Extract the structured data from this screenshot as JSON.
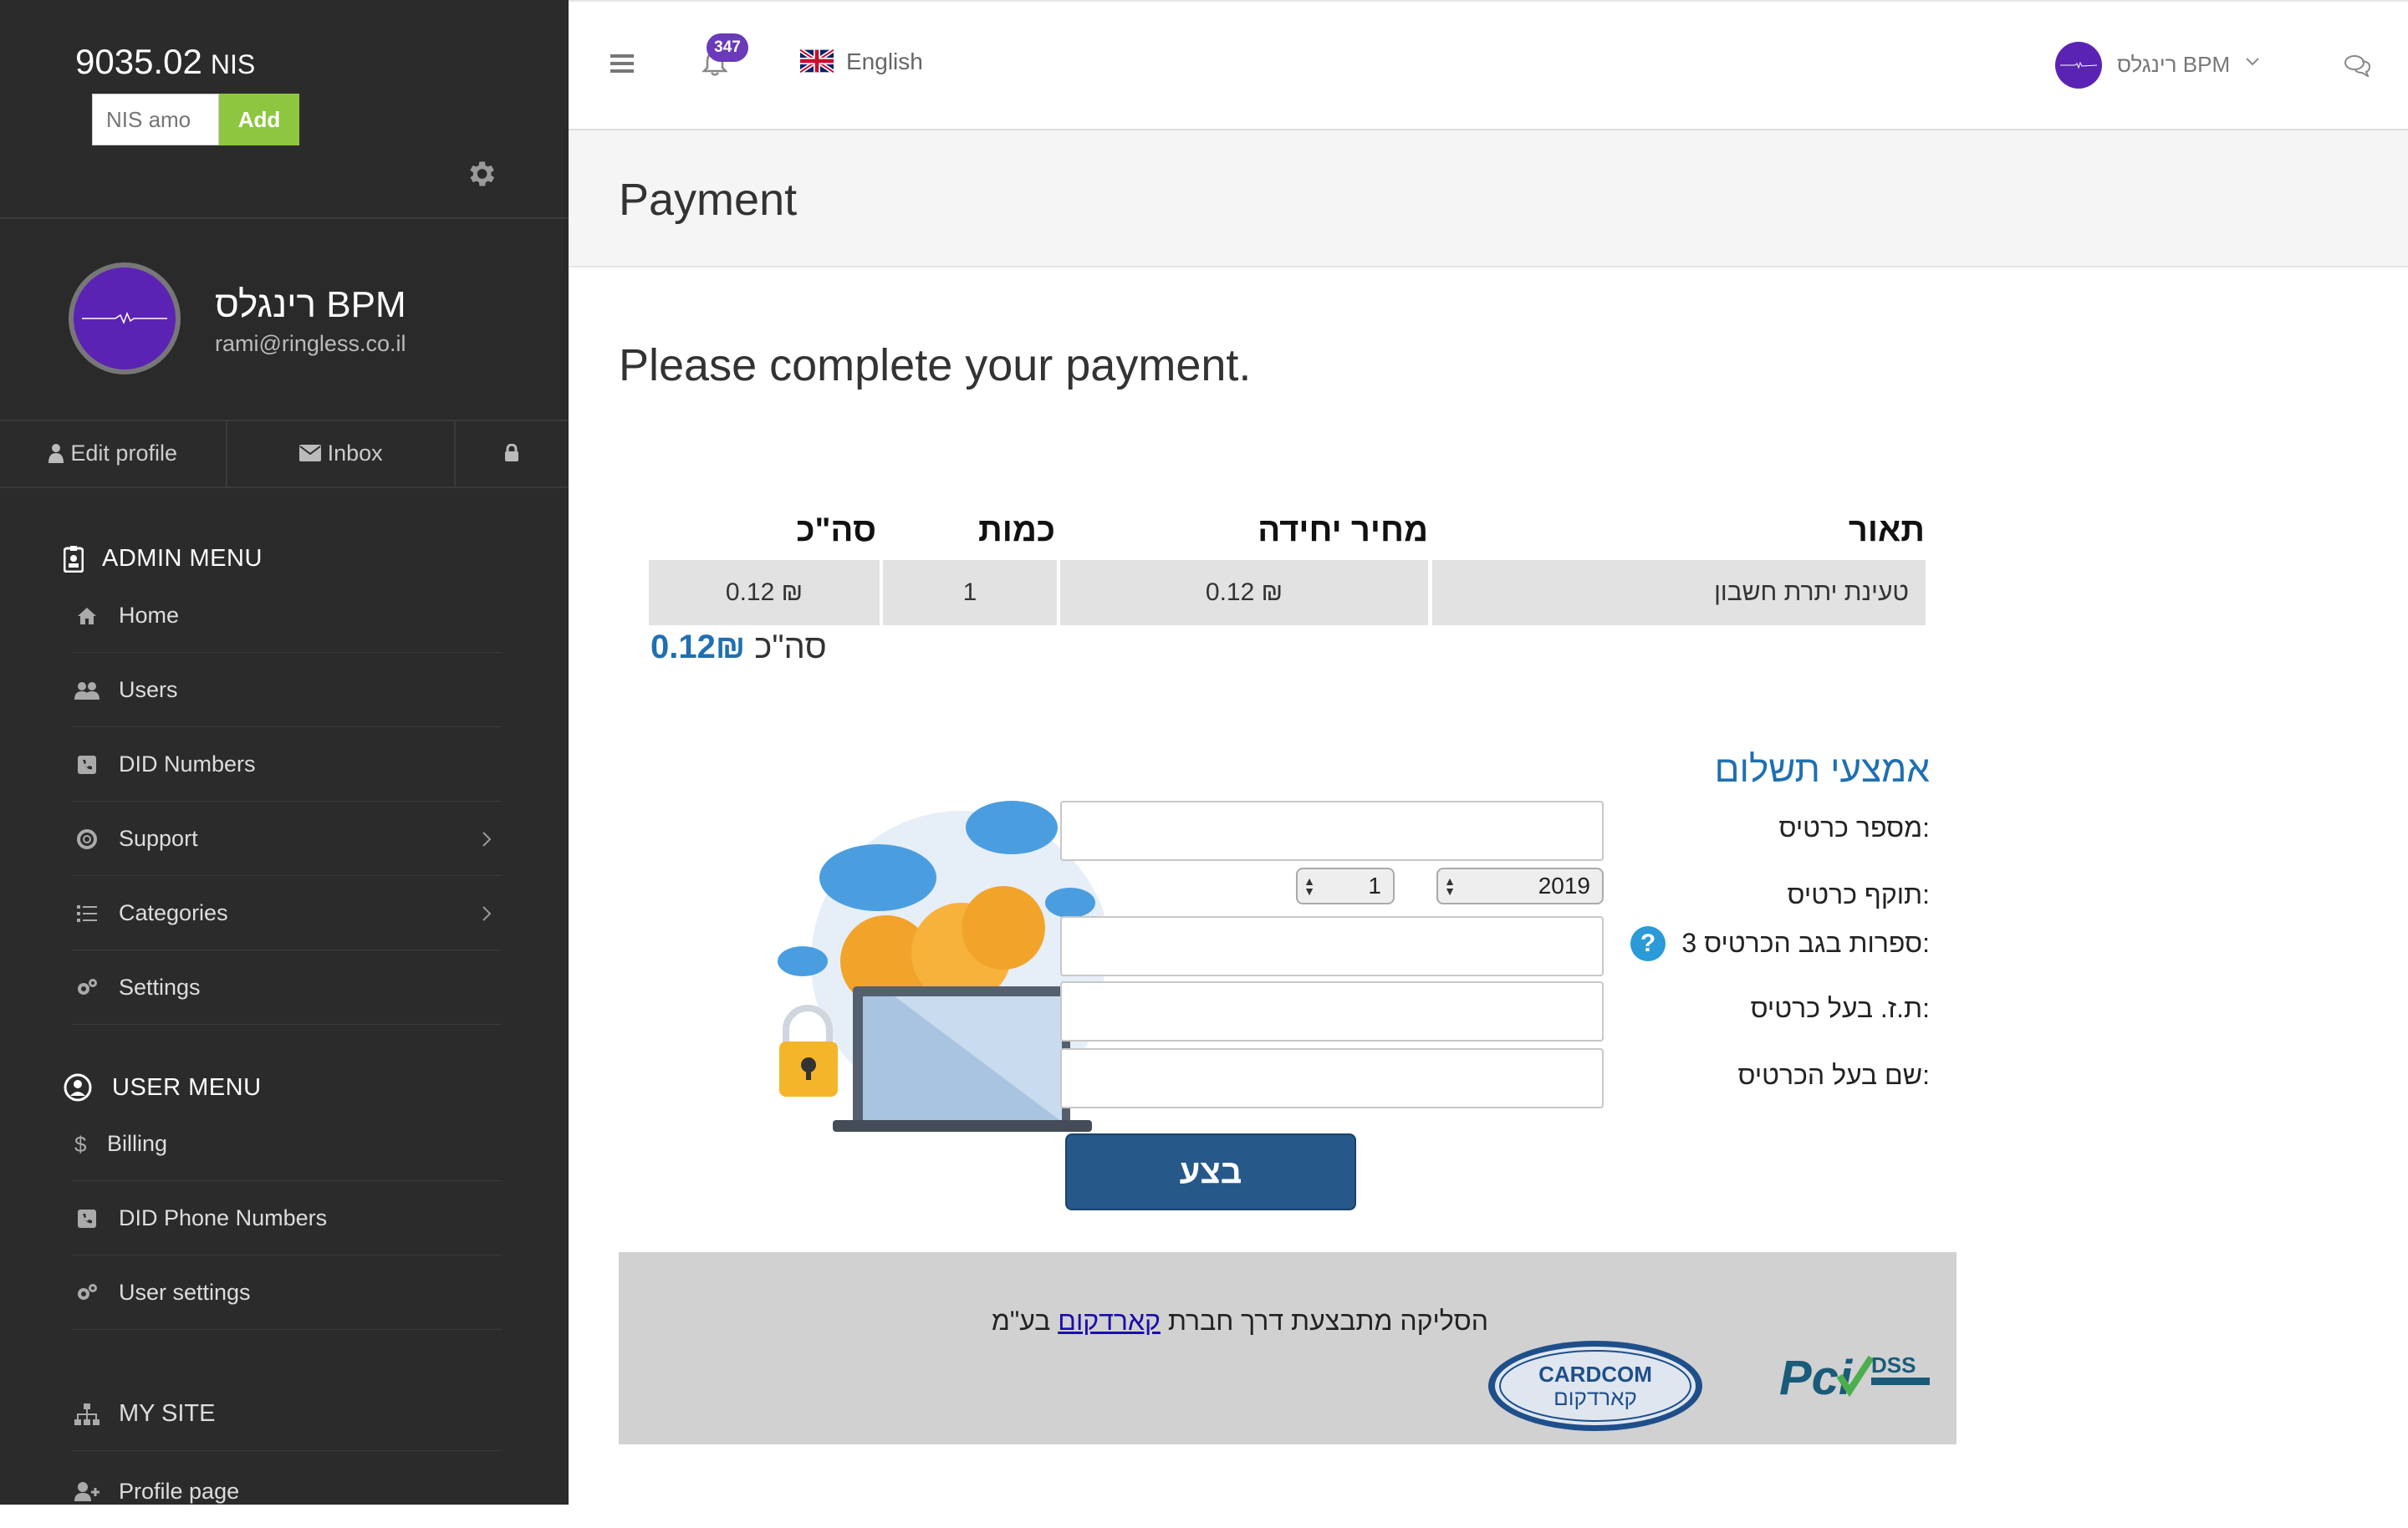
{
  "sidebar": {
    "balance": "9035.02",
    "currency": "NIS",
    "amount_placeholder": "NIS amo",
    "add_label": "Add",
    "profile": {
      "name": "רינגלס BPM",
      "email": "rami@ringless.co.il"
    },
    "profile_actions": {
      "edit": "Edit profile",
      "inbox": "Inbox"
    },
    "admin_menu_title": "ADMIN MENU",
    "admin_items": [
      {
        "label": "Home",
        "icon": "home-icon"
      },
      {
        "label": "Users",
        "icon": "users-icon"
      },
      {
        "label": "DID Numbers",
        "icon": "phone-square-icon"
      },
      {
        "label": "Support",
        "icon": "lifebuoy-icon"
      },
      {
        "label": "Categories",
        "icon": "list-icon"
      },
      {
        "label": "Settings",
        "icon": "cogs-icon"
      }
    ],
    "user_menu_title": "USER MENU",
    "user_items": [
      {
        "label": "Billing",
        "icon": "dollar-icon"
      },
      {
        "label": "DID Phone Numbers",
        "icon": "phone-square-icon"
      },
      {
        "label": "User settings",
        "icon": "cogs-icon"
      }
    ],
    "my_site": "MY SITE",
    "profile_page": "Profile page"
  },
  "topbar": {
    "notifications": "347",
    "language": "English",
    "user_name": "רינגלס BPM"
  },
  "page": {
    "title": "Payment",
    "subtitle": "Please complete your payment."
  },
  "order_table": {
    "headers": {
      "description": "תאור",
      "unit_price": "מחיר יחידה",
      "quantity": "כמות",
      "total": "סה\"כ"
    },
    "rows": [
      {
        "description": "טעינת יתרת חשבון",
        "unit_price": "0.12 ₪",
        "quantity": "1",
        "total": "0.12 ₪"
      }
    ],
    "total_label": "סה\"כ",
    "total_value": "0.12₪"
  },
  "payment_form": {
    "title": "אמצעי תשלום",
    "card_number_label": "מספר כרטיס:",
    "expiry_label": "תוקף כרטיס:",
    "expiry_year": "2019",
    "expiry_month": "1",
    "cvv_label": "3 ספרות בגב הכרטיס:",
    "id_label": "ת.ז. בעל כרטיס:",
    "holder_label": "שם בעל הכרטיס:",
    "submit_label": "בצע"
  },
  "footer": {
    "text_before": "הסליקה מתבצעת דרך חברת",
    "link": "קארדקום",
    "text_after": "בע\"מ",
    "cardcom_logo_text": "CARDCOM",
    "cardcom_logo_heb": "קארדקום"
  },
  "colors": {
    "sidebar_bg": "#2b2b2b",
    "accent_purple": "#5b23b3",
    "add_green": "#8dc63f",
    "submit_blue": "#26588a",
    "link_blue": "#1f6fb2"
  }
}
